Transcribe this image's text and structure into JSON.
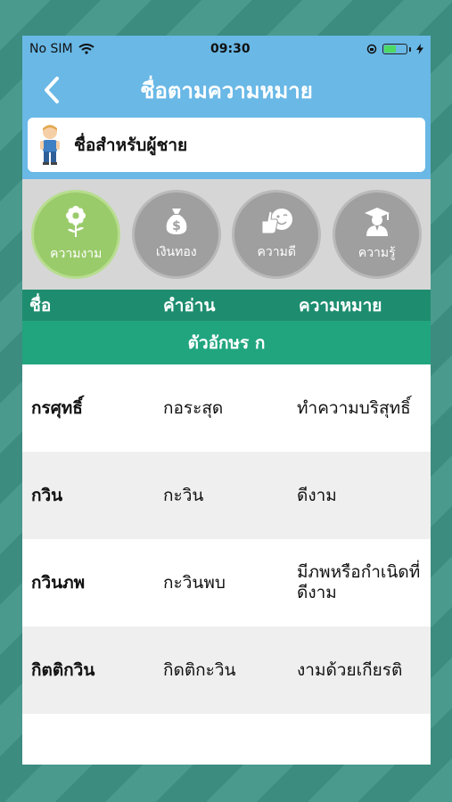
{
  "status_bar": {
    "carrier": "No SIM",
    "time": "09:30"
  },
  "nav": {
    "title": "ชื่อตามความหมาย",
    "back_icon": "chevron-left-icon"
  },
  "category": {
    "label": "ชื่อสำหรับผู้ชาย",
    "icon": "boy-avatar-icon"
  },
  "filters": [
    {
      "label": "ความงาม",
      "icon": "flower-icon",
      "active": true
    },
    {
      "label": "เงินทอง",
      "icon": "money-bag-icon",
      "active": false
    },
    {
      "label": "ความดี",
      "icon": "smile-thumbs-up-icon",
      "active": false
    },
    {
      "label": "ความรู้",
      "icon": "graduate-icon",
      "active": false
    }
  ],
  "table": {
    "headers": {
      "name": "ชื่อ",
      "reading": "คำอ่าน",
      "meaning": "ความหมาย"
    },
    "section": "ตัวอักษร ก",
    "rows": [
      {
        "name": "กรศุทธิ์",
        "reading": "กอระสุด",
        "meaning": "ทำความบริสุทธิ์"
      },
      {
        "name": "กวิน",
        "reading": "กะวิน",
        "meaning": "ดีงาม"
      },
      {
        "name": "กวินภพ",
        "reading": "กะวินพบ",
        "meaning": "มีภพหรือกำเนิดที่ดีงาม"
      },
      {
        "name": "กิตติกวิน",
        "reading": "กิดติกะวิน",
        "meaning": "งามด้วยเกียรติ"
      }
    ]
  },
  "colors": {
    "navbar": "#69b8e6",
    "table_header": "#1e8d6f",
    "section_header": "#21a57f",
    "filter_active": "#9acb6b",
    "filter_inactive": "#9f9f9f"
  }
}
